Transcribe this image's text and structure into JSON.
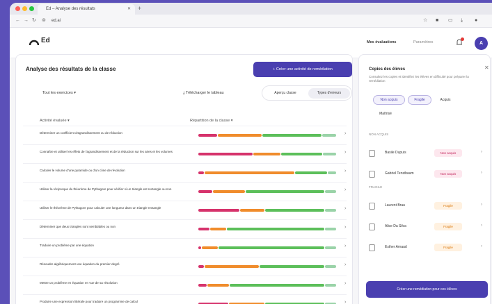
{
  "browser": {
    "tab_title": "Ed – Analyse des résultats",
    "url": "ed.ai"
  },
  "app": {
    "logo": "Ed",
    "nav": [
      "Mes évaluations",
      "Paramètres"
    ],
    "avatar_initial": "A"
  },
  "main": {
    "title": "Analyse des résultats de la classe",
    "primary_button": "+ Créer une activité de remédiation",
    "filter_label": "Tout les exercices ▾",
    "download_label": "Télécharger le tableau",
    "segment": [
      "Aperçu classe",
      "Types d'erreurs"
    ],
    "columns": [
      "Activité évaluée ▾",
      "Répartition de la classe ▾"
    ],
    "rows": [
      {
        "label": "Déterminer un coefficient d'agrandissement ou de réduction",
        "bar": [
          0.14,
          0.32,
          0.44,
          0.1
        ]
      },
      {
        "label": "Connaître et utiliser les effets de l'agrandissement et de la réduction sur les aires et les volumes",
        "bar": [
          0.4,
          0.2,
          0.3,
          0.1
        ]
      },
      {
        "label": "Calculer le volume d'une pyramide ou d'un cône de révolution",
        "bar": [
          0.04,
          0.66,
          0.24,
          0.06
        ]
      },
      {
        "label": "Utiliser la réciproque du théorème de Pythagore pour vérifier si un triangle est rectangle ou non",
        "bar": [
          0.1,
          0.24,
          0.58,
          0.08
        ]
      },
      {
        "label": "Utiliser le théorème de Pythagore pour calculer une longueur dans un triangle rectangle",
        "bar": [
          0.3,
          0.18,
          0.44,
          0.08
        ]
      },
      {
        "label": "Déterminer que deux triangles sont semblables ou non",
        "bar": [
          0.08,
          0.12,
          0.72,
          0.08
        ]
      },
      {
        "label": "Traduire un problème par une équation",
        "bar": [
          0.02,
          0.12,
          0.78,
          0.08
        ]
      },
      {
        "label": "Résoudre algébriquement une équation du premier degré",
        "bar": [
          0.04,
          0.4,
          0.48,
          0.08
        ]
      },
      {
        "label": "Mettre un problème en équation en vue de sa résolution",
        "bar": [
          0.06,
          0.16,
          0.7,
          0.08
        ]
      },
      {
        "label": "Produire une expression littérale pour traduire un programme de calcul",
        "bar": [
          0.22,
          0.26,
          0.44,
          0.08
        ]
      }
    ]
  },
  "side": {
    "title": "Copies des élèves",
    "subtitle": "Consultez les copies et identifiez les élèves en difficulté pour préparer la remédiation",
    "chips": [
      "Non acquis",
      "Fragile",
      "Acquis",
      "Maîtrisé"
    ],
    "sections": [
      {
        "label": "NON ACQUIS",
        "students": [
          {
            "name": "Basile Dupuis",
            "badge": "Non acquis"
          },
          {
            "name": "Gabriel Tenzibaum",
            "badge": "Non acquis"
          }
        ]
      },
      {
        "label": "FRAGILE",
        "students": [
          {
            "name": "Laurent Brau",
            "badge": "Fragile"
          },
          {
            "name": "Alice Da Silva",
            "badge": "Fragile"
          },
          {
            "name": "Esther Arnaud",
            "badge": "Fragile"
          }
        ]
      }
    ],
    "cta": "Créer une remédiation pour ces élèves"
  },
  "colors": {
    "accent": "#4a3fb0",
    "bar": [
      "#d6336c",
      "#f08c2c",
      "#5cbf5a",
      "#9ad3a8"
    ]
  }
}
